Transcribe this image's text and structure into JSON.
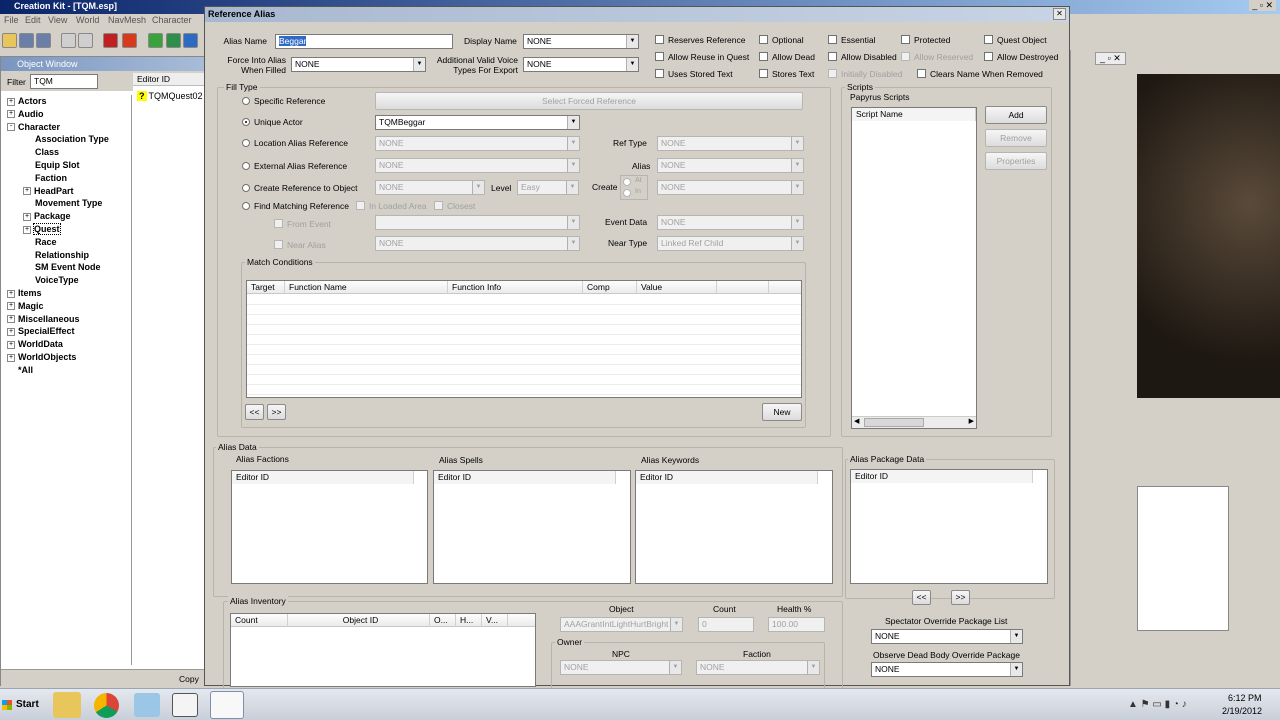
{
  "app": {
    "title": "Creation Kit - [TQM.esp]",
    "menu": [
      "File",
      "Edit",
      "View",
      "World",
      "NavMesh",
      "Character"
    ]
  },
  "object_window": {
    "title": "Object Window",
    "filter_label": "Filter",
    "filter_value": "TQM",
    "col_editor_id": "Editor ID",
    "result": "TQMQuest02",
    "tree": [
      {
        "label": "Actors",
        "indent": 0,
        "exp": "+"
      },
      {
        "label": "Audio",
        "indent": 0,
        "exp": "+"
      },
      {
        "label": "Character",
        "indent": 0,
        "exp": "-"
      },
      {
        "label": "Association Type",
        "indent": 1,
        "exp": ""
      },
      {
        "label": "Class",
        "indent": 1,
        "exp": ""
      },
      {
        "label": "Equip Slot",
        "indent": 1,
        "exp": ""
      },
      {
        "label": "Faction",
        "indent": 1,
        "exp": ""
      },
      {
        "label": "HeadPart",
        "indent": 1,
        "exp": "+"
      },
      {
        "label": "Movement Type",
        "indent": 1,
        "exp": ""
      },
      {
        "label": "Package",
        "indent": 1,
        "exp": "+"
      },
      {
        "label": "Quest",
        "indent": 1,
        "exp": "+",
        "selected": true
      },
      {
        "label": "Race",
        "indent": 1,
        "exp": ""
      },
      {
        "label": "Relationship",
        "indent": 1,
        "exp": ""
      },
      {
        "label": "SM Event Node",
        "indent": 1,
        "exp": ""
      },
      {
        "label": "VoiceType",
        "indent": 1,
        "exp": ""
      },
      {
        "label": "Items",
        "indent": 0,
        "exp": "+"
      },
      {
        "label": "Magic",
        "indent": 0,
        "exp": "+"
      },
      {
        "label": "Miscellaneous",
        "indent": 0,
        "exp": "+"
      },
      {
        "label": "SpecialEffect",
        "indent": 0,
        "exp": "+"
      },
      {
        "label": "WorldData",
        "indent": 0,
        "exp": "+"
      },
      {
        "label": "WorldObjects",
        "indent": 0,
        "exp": "+"
      },
      {
        "label": "*All",
        "indent": 0,
        "exp": ""
      }
    ],
    "status": "Copy"
  },
  "dialog": {
    "title": "Reference Alias",
    "alias_name_label": "Alias Name",
    "alias_name": "Beggar",
    "display_name_label": "Display Name",
    "display_name": "NONE",
    "force_into_label": "Force Into Alias\nWhen Filled",
    "force_into": "NONE",
    "voice_label": "Additional Valid Voice\nTypes For Export",
    "voice": "NONE",
    "flags": [
      [
        "Reserves Reference",
        "Optional",
        "Essential",
        "Protected",
        "Quest Object"
      ],
      [
        "Allow Reuse in Quest",
        "Allow Dead",
        "Allow Disabled",
        "Allow Reserved",
        "Allow Destroyed"
      ],
      [
        "Uses Stored Text",
        "Stores Text",
        "Initially Disabled",
        "Clears Name When Removed"
      ]
    ],
    "fill_type": {
      "label": "Fill Type",
      "specific": "Specific Reference",
      "select_forced": "Select Forced Reference",
      "unique": "Unique Actor",
      "unique_value": "TQMBeggar",
      "location": "Location Alias Reference",
      "external": "External Alias Reference",
      "create": "Create Reference to Object",
      "find": "Find Matching Reference",
      "in_loaded": "In Loaded Area",
      "closest": "Closest",
      "from_event": "From Event",
      "near_alias": "Near Alias",
      "ref_type_label": "Ref Type",
      "alias_label": "Alias",
      "level_label": "Level",
      "level_value": "Easy",
      "create_label": "Create",
      "at": "At",
      "in": "In",
      "event_data_label": "Event Data",
      "near_type_label": "Near Type",
      "near_type_value": "Linked Ref Child",
      "none": "NONE"
    },
    "match": {
      "label": "Match Conditions",
      "cols": [
        "Target",
        "Function Name",
        "Function Info",
        "Comp",
        "Value"
      ],
      "prev": "<<",
      "next": ">>",
      "new": "New"
    },
    "scripts": {
      "label": "Scripts",
      "papyrus": "Papyrus Scripts",
      "col": "Script Name",
      "add": "Add",
      "remove": "Remove",
      "properties": "Properties"
    },
    "alias_data": {
      "label": "Alias Data",
      "factions": "Alias Factions",
      "spells": "Alias Spells",
      "keywords": "Alias Keywords",
      "package": "Alias Package Data",
      "editor_id": "Editor ID",
      "prev": "<<",
      "next": ">>"
    },
    "inventory": {
      "label": "Alias Inventory",
      "cols": [
        "Count",
        "Object ID",
        "O...",
        "H...",
        "V..."
      ],
      "object_label": "Object",
      "object_value": "AAAGrantIntLightHurtBright",
      "count_label": "Count",
      "count_value": "0",
      "health_label": "Health %",
      "health_value": "100.00",
      "owner_label": "Owner",
      "npc_label": "NPC",
      "npc_value": "NONE",
      "faction_label": "Faction",
      "faction_value": "NONE"
    },
    "spectator_label": "Spectator Override Package List",
    "spectator_value": "NONE",
    "observe_label": "Observe Dead Body Override Package",
    "observe_value": "NONE"
  },
  "taskbar": {
    "start": "Start",
    "time": "6:12 PM",
    "date": "2/19/2012"
  }
}
